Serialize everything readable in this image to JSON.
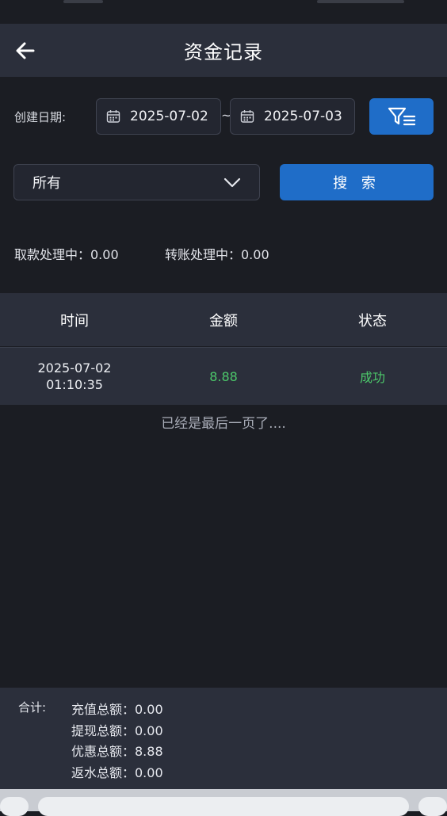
{
  "header": {
    "title": "资金记录",
    "back_icon": "arrow-left-icon"
  },
  "filter": {
    "date_label": "创建日期:",
    "start_date": "2025-07-02",
    "separator": "~",
    "end_date": "2025-07-03",
    "calendar_icon": "calendar-icon",
    "filter_icon": "filter-icon"
  },
  "type_select": {
    "selected": "所有",
    "chevron_icon": "chevron-down-icon"
  },
  "search_button": {
    "label": "搜 索"
  },
  "processing": {
    "withdraw": "取款处理中：0.00",
    "transfer": "转账处理中：0.00"
  },
  "table": {
    "headers": [
      "时间",
      "金额",
      "状态"
    ],
    "rows": [
      {
        "date": "2025-07-02",
        "time": "01:10:35",
        "amount": "8.88",
        "status": "成功"
      }
    ],
    "end_message": "已经是最后一页了...."
  },
  "totals": {
    "label": "合计:",
    "lines": [
      "充值总额：0.00",
      "提现总额：0.00",
      "优惠总额：8.88",
      "返水总额：0.00"
    ]
  },
  "colors": {
    "background": "#1b1d23",
    "panel": "#2b2f3b",
    "accent": "#1f6dc8",
    "success": "#4cc76a"
  }
}
